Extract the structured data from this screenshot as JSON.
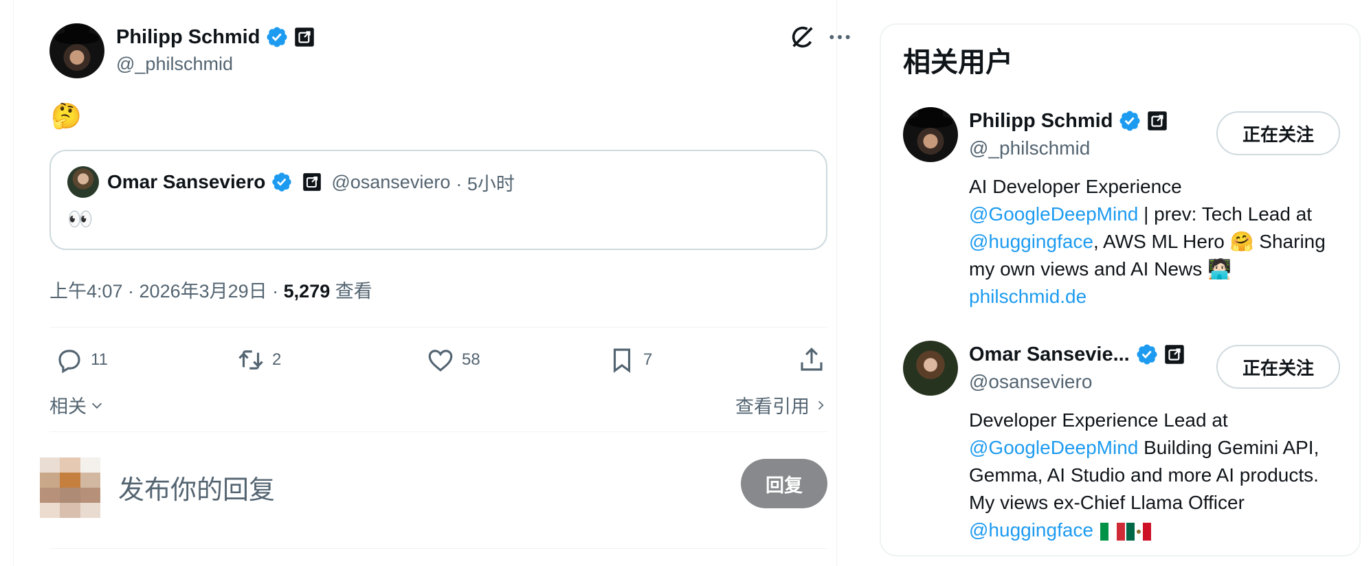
{
  "tweet": {
    "author": {
      "name": "Philipp Schmid",
      "handle": "@_philschmid"
    },
    "text_emoji": "🤔",
    "quote": {
      "name": "Omar Sanseviero",
      "handle": "@osanseviero",
      "time": "· 5小时",
      "text": "👀"
    },
    "meta": {
      "datetime": "上午4:07 · 2026年3月29日 · ",
      "views_count": "5,279",
      "views_label": " 查看"
    },
    "actions": {
      "replies": "11",
      "retweets": "2",
      "likes": "58",
      "bookmarks": "7"
    },
    "related_label": "相关",
    "view_quotes_label": "查看引用",
    "reply_placeholder": "发布你的回复",
    "reply_button": "回复"
  },
  "sidebar": {
    "title": "相关用户",
    "users": [
      {
        "name": "Philipp Schmid",
        "handle": "@_philschmid",
        "follow_label": "正在关注",
        "bio_1": "AI Developer Experience ",
        "bio_link_1": "@GoogleDeepMind",
        "bio_2": " | prev: Tech Lead at ",
        "bio_link_2": "@huggingface",
        "bio_3": ", AWS ML Hero 🤗 Sharing my own views and AI News 🧑🏻‍💻 ",
        "bio_link_3": "philschmid.de"
      },
      {
        "name": "Omar Sansevie...",
        "handle": "@osanseviero",
        "follow_label": "正在关注",
        "bio_1": "Developer Experience Lead at ",
        "bio_link_1": "@GoogleDeepMind",
        "bio_2": " Building Gemini API, Gemma, AI Studio and more AI products. My views ex-Chief Llama Officer ",
        "bio_link_2": "@huggingface"
      }
    ]
  },
  "colors": {
    "verified": "#1d9bf0",
    "link": "#1d9bf0",
    "muted": "#536471",
    "reply_button_bg": "#87898c"
  },
  "icons": [
    "verified-badge-icon",
    "affiliate-badge-icon",
    "grok-icon",
    "more-icon",
    "reply-icon",
    "retweet-icon",
    "like-icon",
    "bookmark-icon",
    "share-icon",
    "chevron-down-icon",
    "chevron-right-icon",
    "flag-italy-icon",
    "flag-mexico-icon"
  ]
}
